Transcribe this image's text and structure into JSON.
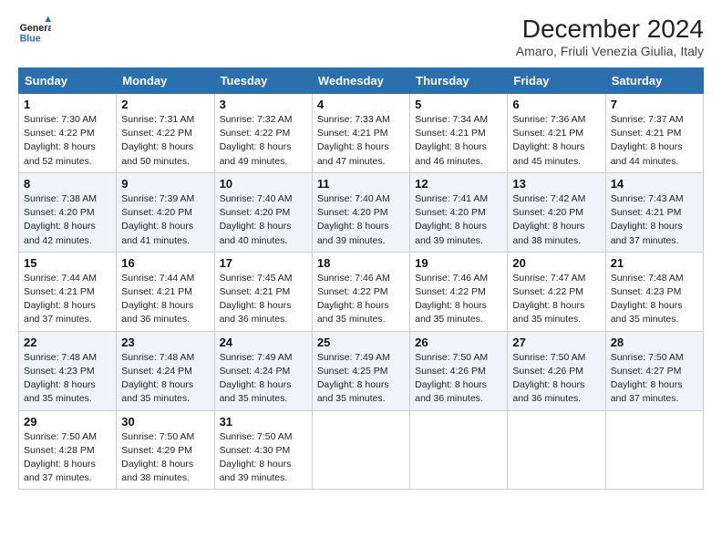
{
  "header": {
    "logo_line1": "General",
    "logo_line2": "Blue",
    "month_title": "December 2024",
    "subtitle": "Amaro, Friuli Venezia Giulia, Italy"
  },
  "weekdays": [
    "Sunday",
    "Monday",
    "Tuesday",
    "Wednesday",
    "Thursday",
    "Friday",
    "Saturday"
  ],
  "weeks": [
    [
      {
        "day": "1",
        "sunrise": "7:30 AM",
        "sunset": "4:22 PM",
        "daylight": "8 hours and 52 minutes."
      },
      {
        "day": "2",
        "sunrise": "7:31 AM",
        "sunset": "4:22 PM",
        "daylight": "8 hours and 50 minutes."
      },
      {
        "day": "3",
        "sunrise": "7:32 AM",
        "sunset": "4:22 PM",
        "daylight": "8 hours and 49 minutes."
      },
      {
        "day": "4",
        "sunrise": "7:33 AM",
        "sunset": "4:21 PM",
        "daylight": "8 hours and 47 minutes."
      },
      {
        "day": "5",
        "sunrise": "7:34 AM",
        "sunset": "4:21 PM",
        "daylight": "8 hours and 46 minutes."
      },
      {
        "day": "6",
        "sunrise": "7:36 AM",
        "sunset": "4:21 PM",
        "daylight": "8 hours and 45 minutes."
      },
      {
        "day": "7",
        "sunrise": "7:37 AM",
        "sunset": "4:21 PM",
        "daylight": "8 hours and 44 minutes."
      }
    ],
    [
      {
        "day": "8",
        "sunrise": "7:38 AM",
        "sunset": "4:20 PM",
        "daylight": "8 hours and 42 minutes."
      },
      {
        "day": "9",
        "sunrise": "7:39 AM",
        "sunset": "4:20 PM",
        "daylight": "8 hours and 41 minutes."
      },
      {
        "day": "10",
        "sunrise": "7:40 AM",
        "sunset": "4:20 PM",
        "daylight": "8 hours and 40 minutes."
      },
      {
        "day": "11",
        "sunrise": "7:40 AM",
        "sunset": "4:20 PM",
        "daylight": "8 hours and 39 minutes."
      },
      {
        "day": "12",
        "sunrise": "7:41 AM",
        "sunset": "4:20 PM",
        "daylight": "8 hours and 39 minutes."
      },
      {
        "day": "13",
        "sunrise": "7:42 AM",
        "sunset": "4:20 PM",
        "daylight": "8 hours and 38 minutes."
      },
      {
        "day": "14",
        "sunrise": "7:43 AM",
        "sunset": "4:21 PM",
        "daylight": "8 hours and 37 minutes."
      }
    ],
    [
      {
        "day": "15",
        "sunrise": "7:44 AM",
        "sunset": "4:21 PM",
        "daylight": "8 hours and 37 minutes."
      },
      {
        "day": "16",
        "sunrise": "7:44 AM",
        "sunset": "4:21 PM",
        "daylight": "8 hours and 36 minutes."
      },
      {
        "day": "17",
        "sunrise": "7:45 AM",
        "sunset": "4:21 PM",
        "daylight": "8 hours and 36 minutes."
      },
      {
        "day": "18",
        "sunrise": "7:46 AM",
        "sunset": "4:22 PM",
        "daylight": "8 hours and 35 minutes."
      },
      {
        "day": "19",
        "sunrise": "7:46 AM",
        "sunset": "4:22 PM",
        "daylight": "8 hours and 35 minutes."
      },
      {
        "day": "20",
        "sunrise": "7:47 AM",
        "sunset": "4:22 PM",
        "daylight": "8 hours and 35 minutes."
      },
      {
        "day": "21",
        "sunrise": "7:48 AM",
        "sunset": "4:23 PM",
        "daylight": "8 hours and 35 minutes."
      }
    ],
    [
      {
        "day": "22",
        "sunrise": "7:48 AM",
        "sunset": "4:23 PM",
        "daylight": "8 hours and 35 minutes."
      },
      {
        "day": "23",
        "sunrise": "7:48 AM",
        "sunset": "4:24 PM",
        "daylight": "8 hours and 35 minutes."
      },
      {
        "day": "24",
        "sunrise": "7:49 AM",
        "sunset": "4:24 PM",
        "daylight": "8 hours and 35 minutes."
      },
      {
        "day": "25",
        "sunrise": "7:49 AM",
        "sunset": "4:25 PM",
        "daylight": "8 hours and 35 minutes."
      },
      {
        "day": "26",
        "sunrise": "7:50 AM",
        "sunset": "4:26 PM",
        "daylight": "8 hours and 36 minutes."
      },
      {
        "day": "27",
        "sunrise": "7:50 AM",
        "sunset": "4:26 PM",
        "daylight": "8 hours and 36 minutes."
      },
      {
        "day": "28",
        "sunrise": "7:50 AM",
        "sunset": "4:27 PM",
        "daylight": "8 hours and 37 minutes."
      }
    ],
    [
      {
        "day": "29",
        "sunrise": "7:50 AM",
        "sunset": "4:28 PM",
        "daylight": "8 hours and 37 minutes."
      },
      {
        "day": "30",
        "sunrise": "7:50 AM",
        "sunset": "4:29 PM",
        "daylight": "8 hours and 38 minutes."
      },
      {
        "day": "31",
        "sunrise": "7:50 AM",
        "sunset": "4:30 PM",
        "daylight": "8 hours and 39 minutes."
      },
      null,
      null,
      null,
      null
    ]
  ],
  "labels": {
    "sunrise": "Sunrise: ",
    "sunset": "Sunset: ",
    "daylight": "Daylight: "
  }
}
